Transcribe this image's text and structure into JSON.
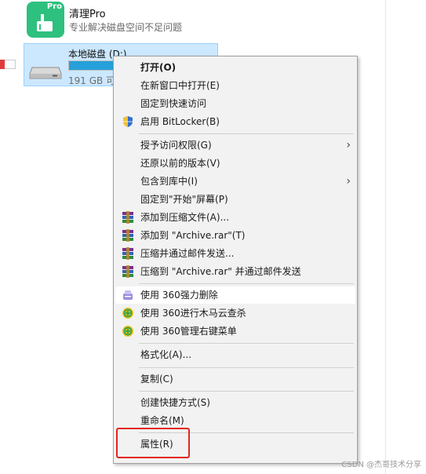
{
  "app": {
    "title": "清理Pro",
    "subtitle": "专业解决磁盘空间不足问题",
    "badge": "Pro",
    "color": "#2ec07e"
  },
  "drive": {
    "name": "本地磁盘 (D:)",
    "free": "191 GB 可",
    "usage_fraction": 0.6
  },
  "menu": {
    "items": [
      {
        "label": "打开(O)",
        "bold": true
      },
      {
        "label": "在新窗口中打开(E)"
      },
      {
        "label": "固定到快速访问"
      },
      {
        "label": "启用 BitLocker(B)",
        "icon": "shield-icon"
      },
      {
        "label": "授予访问权限(G)",
        "submenu": true
      },
      {
        "label": "还原以前的版本(V)"
      },
      {
        "label": "包含到库中(I)",
        "submenu": true
      },
      {
        "label": "固定到\"开始\"屏幕(P)"
      },
      {
        "label": "添加到压缩文件(A)...",
        "icon": "winrar-icon"
      },
      {
        "label": "添加到 \"Archive.rar\"(T)",
        "icon": "winrar-icon"
      },
      {
        "label": "压缩并通过邮件发送...",
        "icon": "winrar-icon"
      },
      {
        "label": "压缩到 \"Archive.rar\" 并通过邮件发送",
        "icon": "winrar-icon"
      },
      {
        "label": "使用 360强力删除",
        "icon": "360-delete-icon"
      },
      {
        "label": "使用 360进行木马云查杀",
        "icon": "360-scan-icon"
      },
      {
        "label": "使用 360管理右键菜单",
        "icon": "360-menu-icon"
      },
      {
        "label": "格式化(A)..."
      },
      {
        "label": "复制(C)"
      },
      {
        "label": "创建快捷方式(S)"
      },
      {
        "label": "重命名(M)"
      },
      {
        "label": "属性(R)"
      }
    ],
    "submenu_glyph": "›"
  },
  "watermark": "CSDN @杰哥技术分享",
  "colors": {
    "selection": "#cce8ff",
    "menu_bg": "#f2f2f2",
    "highlight_box": "#e3261f"
  }
}
